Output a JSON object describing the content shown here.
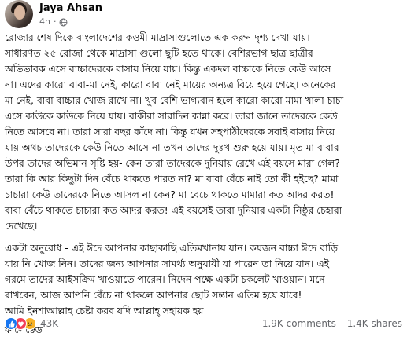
{
  "post": {
    "author_name": "Jaya Ahsan",
    "time": "4h",
    "separator": "·",
    "paragraphs": [
      "রোজার শেষ দিকে বাংলাদেশের কওমী মাদ্রাসাগুলোতে এক করুন দৃশ্য দেখা যায়।\nসাধারণত ২৫ রোজা থেকে মাদ্রাসা গুলো ছুটি হতে থাকে। বেশিরভাগ ছাত্র ছাত্রীর\nঅভিভাবক এসে বাচ্চাদেরকে বাসায় নিয়ে যায়। কিন্তু একদল বাচ্চাকে নিতে কেউ আসে\nনা। এদের কারো বাবা-মা নেই, কারো বাবা নেই মায়ের অন্যত্র বিয়ে হয়ে গেছে। অনেকের\nমা নেই, বাবা বাচ্চার খোজ রাখে না। খুব বেশি ভাগ্যবান হলে কারো কারো মামা খালা চাচা\nএসে কাউকে কাউকে নিয়ে যায়। বাকীরা সারাদিন কান্না করে। তারা জানে তাদেরকে কেউ\nনিতে আসবে না। তারা সারা বছর কাঁদে না। কিন্তু যখন সহপাঠীদেরকে সবাই বাসায় নিয়ে\nযায় অথচ তাদেরকে কেউ নিতে আসে না তখন তাদের দুঃখ শুরু হয়ে যায়। মৃত মা বাবার\nউপর তাদের অভিমান সৃষ্টি হয়- কেন তারা তাদেরকে দুনিয়ায় রেখে এই বয়সে মারা গেল?\nতারা কি আর কিছুটা দিন বেঁচে থাকতে পারত না? মা বাবা বেঁচে নাই তো কী হইছে? মামা\nচাচারা কেউ তাদেরকে নিতে আসল না কেন? মা বেচে থাকতে মামারা কত আদর করত!\nবাবা বেঁচে থাকতে চাচারা কত আদর করত! এই বয়সেই তারা দুনিয়ার একটা নিষ্ঠুর চেহারা\nদেখেছে।",
      "একটা অনুরোধ - এই ঈদে আপনার কাছাকাছি এতিমখানায় যান। কয়জন বাচ্চা ঈদে বাড়ি\nযায় নি খোজ নিন। তাদের জন্য আপনার সামর্থ্য অনুযায়ী যা পারেন তা নিয়ে যান। এই\nগরমে তাদের আইসক্রিম খাওয়াতে পারেন। নিদেন পক্ষে একটা চকলেট খাওয়ান। মনে\nরাখবেন, আজ আপনি বেঁচে না থাকলে আপনার ছোট সন্তান এতিম হয়ে যাবে!\nআমি ইনশাআল্লাহ চেষ্টা করব যদি  আল্লাহ্ সহায়ক হয়",
      "কালেক্টেড"
    ]
  },
  "footer": {
    "reaction_count": "43K",
    "comments": "1.9K comments",
    "shares": "1.4K shares",
    "reaction_icons": [
      "like-icon",
      "love-icon",
      "sad-icon"
    ]
  },
  "colors": {
    "like": "#1877f2",
    "love": "#f33e58",
    "sad": "#f7b125",
    "secondary_text": "#65676b"
  }
}
